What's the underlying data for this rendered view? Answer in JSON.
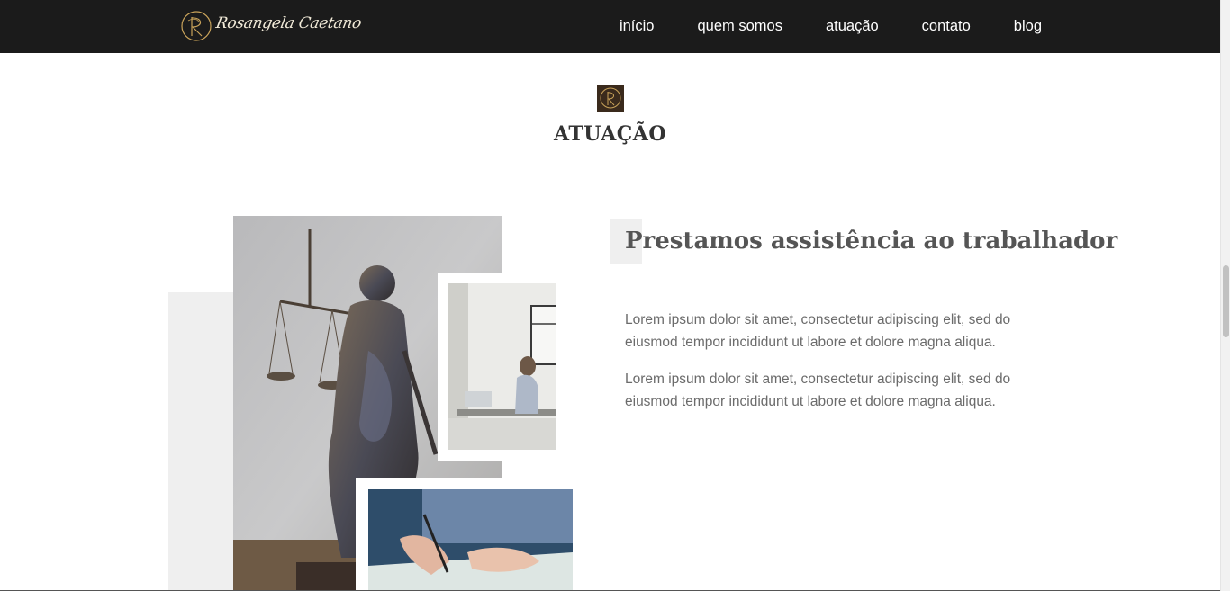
{
  "header": {
    "logo_text": "Rosangela Caetano",
    "nav": [
      {
        "label": "início"
      },
      {
        "label": "quem somos"
      },
      {
        "label": "atuação"
      },
      {
        "label": "contato"
      },
      {
        "label": "blog"
      }
    ]
  },
  "section": {
    "title": "ATUAÇÃO",
    "subheading": "Prestamos assistência ao trabalhador",
    "paragraphs": [
      "Lorem ipsum dolor sit amet, consectetur adipiscing elit, sed do eiusmod tempor incididunt ut labore et dolore magna aliqua.",
      "Lorem ipsum dolor sit amet, consectetur adipiscing elit, sed do eiusmod tempor incididunt ut labore et dolore magna aliqua."
    ]
  },
  "colors": {
    "header_bg": "#1b1b1b",
    "gold": "#c9a35a",
    "icon_bg": "#3a2a1c",
    "body_text": "#6b6b6b"
  },
  "images": [
    {
      "name": "lady-justice-statue-photo"
    },
    {
      "name": "office-woman-laptop-photo"
    },
    {
      "name": "hands-signing-document-photo"
    }
  ]
}
